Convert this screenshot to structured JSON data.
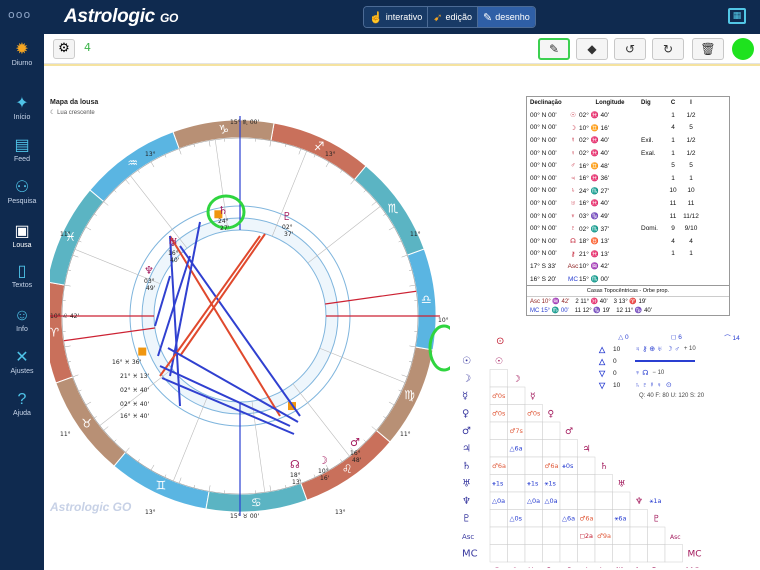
{
  "app": {
    "brand": "Astrologic",
    "brand_suffix": "GO",
    "dots": "ooo"
  },
  "modes": [
    {
      "label": "interativo",
      "icon": "hand-icon",
      "active": false
    },
    {
      "label": "edição",
      "icon": "pointer-icon",
      "active": false
    },
    {
      "label": "desenho",
      "icon": "brush-icon",
      "active": true
    }
  ],
  "sidebar": [
    {
      "label": "Diurno",
      "icon": "sun-gear-icon",
      "active": false
    },
    {
      "label": "Início",
      "icon": "sparkle-icon",
      "active": false
    },
    {
      "label": "Feed",
      "icon": "feed-icon",
      "active": false
    },
    {
      "label": "Pesquisa",
      "icon": "people-icon",
      "active": false
    },
    {
      "label": "Lousa",
      "icon": "board-icon",
      "active": true
    },
    {
      "label": "Textos",
      "icon": "document-icon",
      "active": false
    },
    {
      "label": "Info",
      "icon": "info-person-icon",
      "active": false
    },
    {
      "label": "Ajustes",
      "icon": "wrench-icon",
      "active": false
    },
    {
      "label": "Ajuda",
      "icon": "help-icon",
      "active": false
    }
  ],
  "toolbar": {
    "count": "4"
  },
  "map": {
    "title": "Mapa da lousa",
    "subtitle": "Lua crescente",
    "watermark": "Astrologic GO",
    "degrees": {
      "top": "15° ♏ 00'",
      "bottom": "15° ♉ 00'",
      "asc": "10° ♒ 00'",
      "dsc": "10° ♌ 42'",
      "c1": "13°",
      "c2": "11°",
      "c3": "13°",
      "c4": "11°",
      "c5": "13°",
      "c6": "11°",
      "c7": "13°",
      "c8": "11°"
    },
    "planet_labels": [
      {
        "glyph": "♄",
        "deg": "24°",
        "min": "27'"
      },
      {
        "glyph": "♇",
        "deg": "02°",
        "min": "37'"
      },
      {
        "glyph": "♅",
        "deg": "16°",
        "min": "40'"
      },
      {
        "glyph": "♆",
        "deg": "03°",
        "min": "49'"
      },
      {
        "glyph": "☊",
        "deg": "18°",
        "min": "13'"
      },
      {
        "glyph": "♂",
        "deg": "16°",
        "min": "48'"
      },
      {
        "glyph": "☽",
        "deg": "10°",
        "min": "16'"
      }
    ],
    "left_labels": [
      "16° ♓ 36'",
      "21° ♓ 13'",
      "02° ♓ 40'",
      "02° ♓ 40'",
      "16° ♓ 40'"
    ]
  },
  "declination": {
    "headers": [
      "Declinação",
      "",
      "Longitude",
      "Dig",
      "C",
      "I"
    ],
    "rows": [
      [
        "00° N 00'",
        "☉",
        "02° ♓ 40'",
        "",
        "1",
        "1/2"
      ],
      [
        "00° N 00'",
        "☽",
        "10° ♊ 16'",
        "",
        "4",
        "5"
      ],
      [
        "00° N 00'",
        "☿",
        "02° ♓ 40'",
        "Exil.",
        "1",
        "1/2"
      ],
      [
        "00° N 00'",
        "♀",
        "02° ♓ 40'",
        "Exal.",
        "1",
        "1/2"
      ],
      [
        "00° N 00'",
        "♂",
        "16° ♊ 48'",
        "",
        "5",
        "5"
      ],
      [
        "00° N 00'",
        "♃",
        "16° ♓ 36'",
        "",
        "1",
        "1"
      ],
      [
        "00° N 00'",
        "♄",
        "24° ♏ 27'",
        "",
        "10",
        "10"
      ],
      [
        "00° N 00'",
        "♅",
        "16° ♓ 40'",
        "",
        "11",
        "11"
      ],
      [
        "00° N 00'",
        "♆",
        "03° ♑ 49'",
        "",
        "11",
        "11/12"
      ],
      [
        "00° N 00'",
        "♇",
        "02° ♏ 37'",
        "Domi.",
        "9",
        "9/10"
      ],
      [
        "00° N 00'",
        "☊",
        "18° ♉ 13'",
        "",
        "4",
        "4"
      ],
      [
        "00° N 00'",
        "⚷",
        "21° ♓ 13'",
        "",
        "1",
        "1"
      ],
      [
        "17° S 33'",
        "Asc",
        "10° ♒ 42'",
        "",
        "",
        ""
      ],
      [
        "16° S 20'",
        "MC",
        "15° ♏ 00'",
        "",
        "",
        ""
      ]
    ],
    "houses_caption": "Casas Topocêntricas - Orbe prop.",
    "houses": [
      [
        "Asc 10° ♒ 42'",
        "2 11° ♓ 40'",
        "3 13° ♈ 19'"
      ],
      [
        "MC 15° ♏ 00'",
        "11 12° ♑ 19'",
        "12 11° ♑ 40'"
      ]
    ]
  },
  "elements": {
    "header": [
      "△ 0",
      "◻ 6",
      "⌒ 14"
    ],
    "rows": [
      {
        "icon": "△",
        "value": "10",
        "label": "♃ ⚷ ⊕ ♅",
        "extra": "☽ ♂"
      },
      {
        "icon": "△",
        "value": "0",
        "label": "",
        "extra": ""
      },
      {
        "icon": "▽",
        "value": "0",
        "label": "♆ ☊",
        "extra": ""
      },
      {
        "icon": "▽",
        "value": "10",
        "label": "♄ ♇ ☿ ♀",
        "extra": "⊙"
      }
    ],
    "side": [
      "+ 10",
      "− 10"
    ],
    "totals": "Q: 40   F: 80   U: 120   S: 20"
  },
  "aspects": {
    "rows": [
      "☉",
      "☽",
      "☿",
      "♀",
      "♂",
      "♃",
      "♄",
      "♅",
      "♆",
      "♇",
      "Asc",
      "MC"
    ],
    "cells": [
      {
        "r": 2,
        "c": 0,
        "t": "♂0s",
        "col": "#e05a3a"
      },
      {
        "r": 3,
        "c": 0,
        "t": "♂0s",
        "col": "#e05a3a"
      },
      {
        "r": 3,
        "c": 2,
        "t": "♂0s",
        "col": "#e05a3a"
      },
      {
        "r": 4,
        "c": 1,
        "t": "♂7s",
        "col": "#e05a3a"
      },
      {
        "r": 5,
        "c": 1,
        "t": "△6a",
        "col": "#2a3fd1"
      },
      {
        "r": 6,
        "c": 0,
        "t": "♂6a",
        "col": "#e05a3a"
      },
      {
        "r": 6,
        "c": 3,
        "t": "♂6a",
        "col": "#e05a3a"
      },
      {
        "r": 6,
        "c": 4,
        "t": "⚹0s",
        "col": "#2a3fd1"
      },
      {
        "r": 7,
        "c": 0,
        "t": "⚹1s",
        "col": "#2a3fd1"
      },
      {
        "r": 7,
        "c": 2,
        "t": "⚹1s",
        "col": "#2a3fd1"
      },
      {
        "r": 7,
        "c": 3,
        "t": "⚹1s",
        "col": "#2a3fd1"
      },
      {
        "r": 8,
        "c": 0,
        "t": "△0a",
        "col": "#2a3fd1"
      },
      {
        "r": 8,
        "c": 2,
        "t": "△0a",
        "col": "#2a3fd1"
      },
      {
        "r": 8,
        "c": 3,
        "t": "△0a",
        "col": "#2a3fd1"
      },
      {
        "r": 8,
        "c": 9,
        "t": "⚹1a",
        "col": "#2a3fd1"
      },
      {
        "r": 9,
        "c": 1,
        "t": "△0s",
        "col": "#2a3fd1"
      },
      {
        "r": 9,
        "c": 4,
        "t": "△6a",
        "col": "#2a3fd1"
      },
      {
        "r": 9,
        "c": 5,
        "t": "♂6a",
        "col": "#e05a3a"
      },
      {
        "r": 9,
        "c": 7,
        "t": "⚹6a",
        "col": "#2a3fd1"
      },
      {
        "r": 10,
        "c": 5,
        "t": "◻2a",
        "col": "#c0162b"
      },
      {
        "r": 10,
        "c": 6,
        "t": "♂9a",
        "col": "#e05a3a"
      }
    ]
  },
  "colors": {
    "navy": "#0f2a4f",
    "fire": "#c9705b",
    "earth": "#b89075",
    "air": "#5ab5e2",
    "water": "#5bb4c3",
    "aspect_red": "#e0492d",
    "aspect_blue": "#3040d0",
    "highlight": "#2fd53f"
  }
}
